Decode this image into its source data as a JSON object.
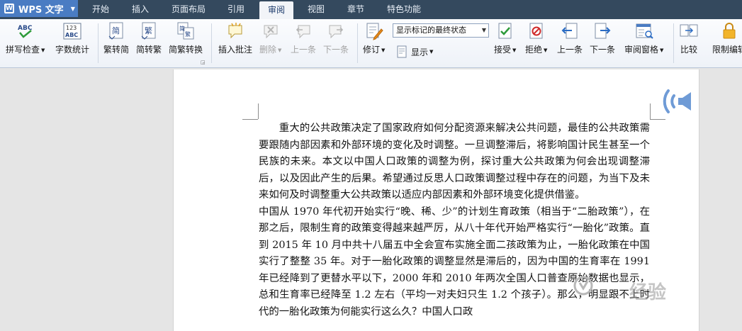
{
  "app": {
    "name": "WPS 文字"
  },
  "menu": {
    "tabs": [
      "开始",
      "插入",
      "页面布局",
      "引用",
      "审阅",
      "视图",
      "章节",
      "特色功能"
    ],
    "active": "审阅"
  },
  "ribbon": {
    "spellcheck": "拼写检查",
    "wordcount": "字数统计",
    "to_simplified": "繁转简",
    "to_traditional": "简转繁",
    "convert": "简繁转换",
    "insert_comment": "插入批注",
    "delete": "删除",
    "prev_comment": "上一条",
    "next_comment": "下一条",
    "track": "修订",
    "display_mode": "显示标记的最终状态",
    "show": "显示",
    "accept": "接受",
    "reject": "拒绝",
    "prev_change": "上一条",
    "next_change": "下一条",
    "review_pane": "审阅窗格",
    "compare": "比较",
    "restrict": "限制编辑"
  },
  "document": {
    "paragraphs": [
      "重大的公共政策决定了国家政府如何分配资源来解决公共问题，最佳的公共政策需要跟随内部因素和外部环境的变化及时调整。一旦调整滞后，将影响国计民生甚至一个民族的未来。本文以中国人口政策的调整为例，探讨重大公共政策为何会出现调整滞后，以及因此产生的后果。希望通过反思人口政策调整过程中存在的问题，为当下及未来如何及时调整重大公共政策以适应内部因素和外部环境变化提供借鉴。",
      "中国从 1970 年代初开始实行“晚、稀、少”的计划生育政策（相当于“二胎政策”），在那之后，限制生育的政策变得越来越严厉，从八十年代开始严格实行“一胎化”政策。直到 2015 年 10 月中共十八届五中全会宣布实施全面二孩政策为止，一胎化政策在中国实行了整整 35 年。对于一胎化政策的调整显然是滞后的，因为中国的生育率在 1991 年已经降到了更替水平以下，2000 年和 2010 年两次全国人口普查原始数据也显示，总和生育率已经降至 1.2 左右（平均一对夫妇只生 1.2 个孩子）。那么，明显跟不上时代的一胎化政策为何能实行这么久？中国人口政"
    ],
    "watermark": "经验"
  }
}
